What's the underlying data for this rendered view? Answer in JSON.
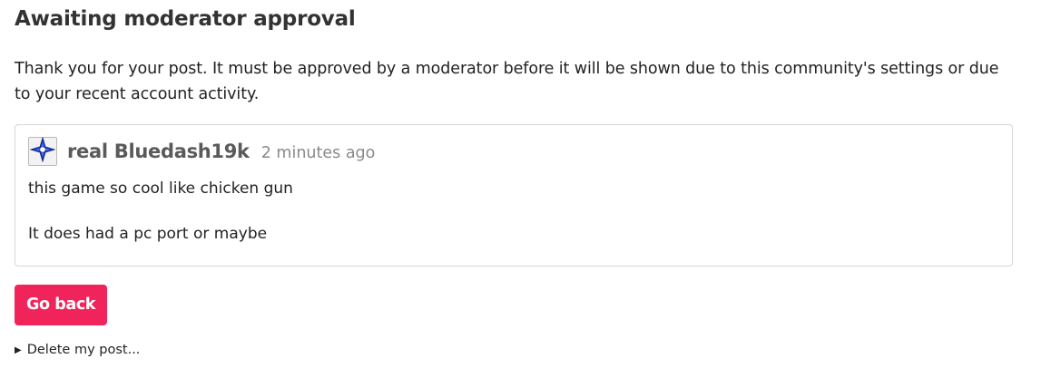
{
  "page": {
    "title": "Awaiting moderator approval",
    "notice": "Thank you for your post. It must be approved by a moderator before it will be shown due to this community's settings or due to your recent account activity."
  },
  "post": {
    "avatar_icon": "shuriken-avatar-icon",
    "username": "real Bluedash19k",
    "time": "2 minutes ago",
    "paragraphs": [
      "this game so cool like chicken gun",
      "It does had a pc port or maybe"
    ]
  },
  "actions": {
    "go_back_label": "Go back",
    "delete_toggle_icon": "triangle-right-icon",
    "delete_label": "Delete my post..."
  },
  "colors": {
    "accent": "#f0245a",
    "text": "#222222",
    "muted": "#8a8a8a",
    "username": "#5a5a5a",
    "border": "#d6d6d6",
    "avatar_blue": "#1a3fc7"
  }
}
